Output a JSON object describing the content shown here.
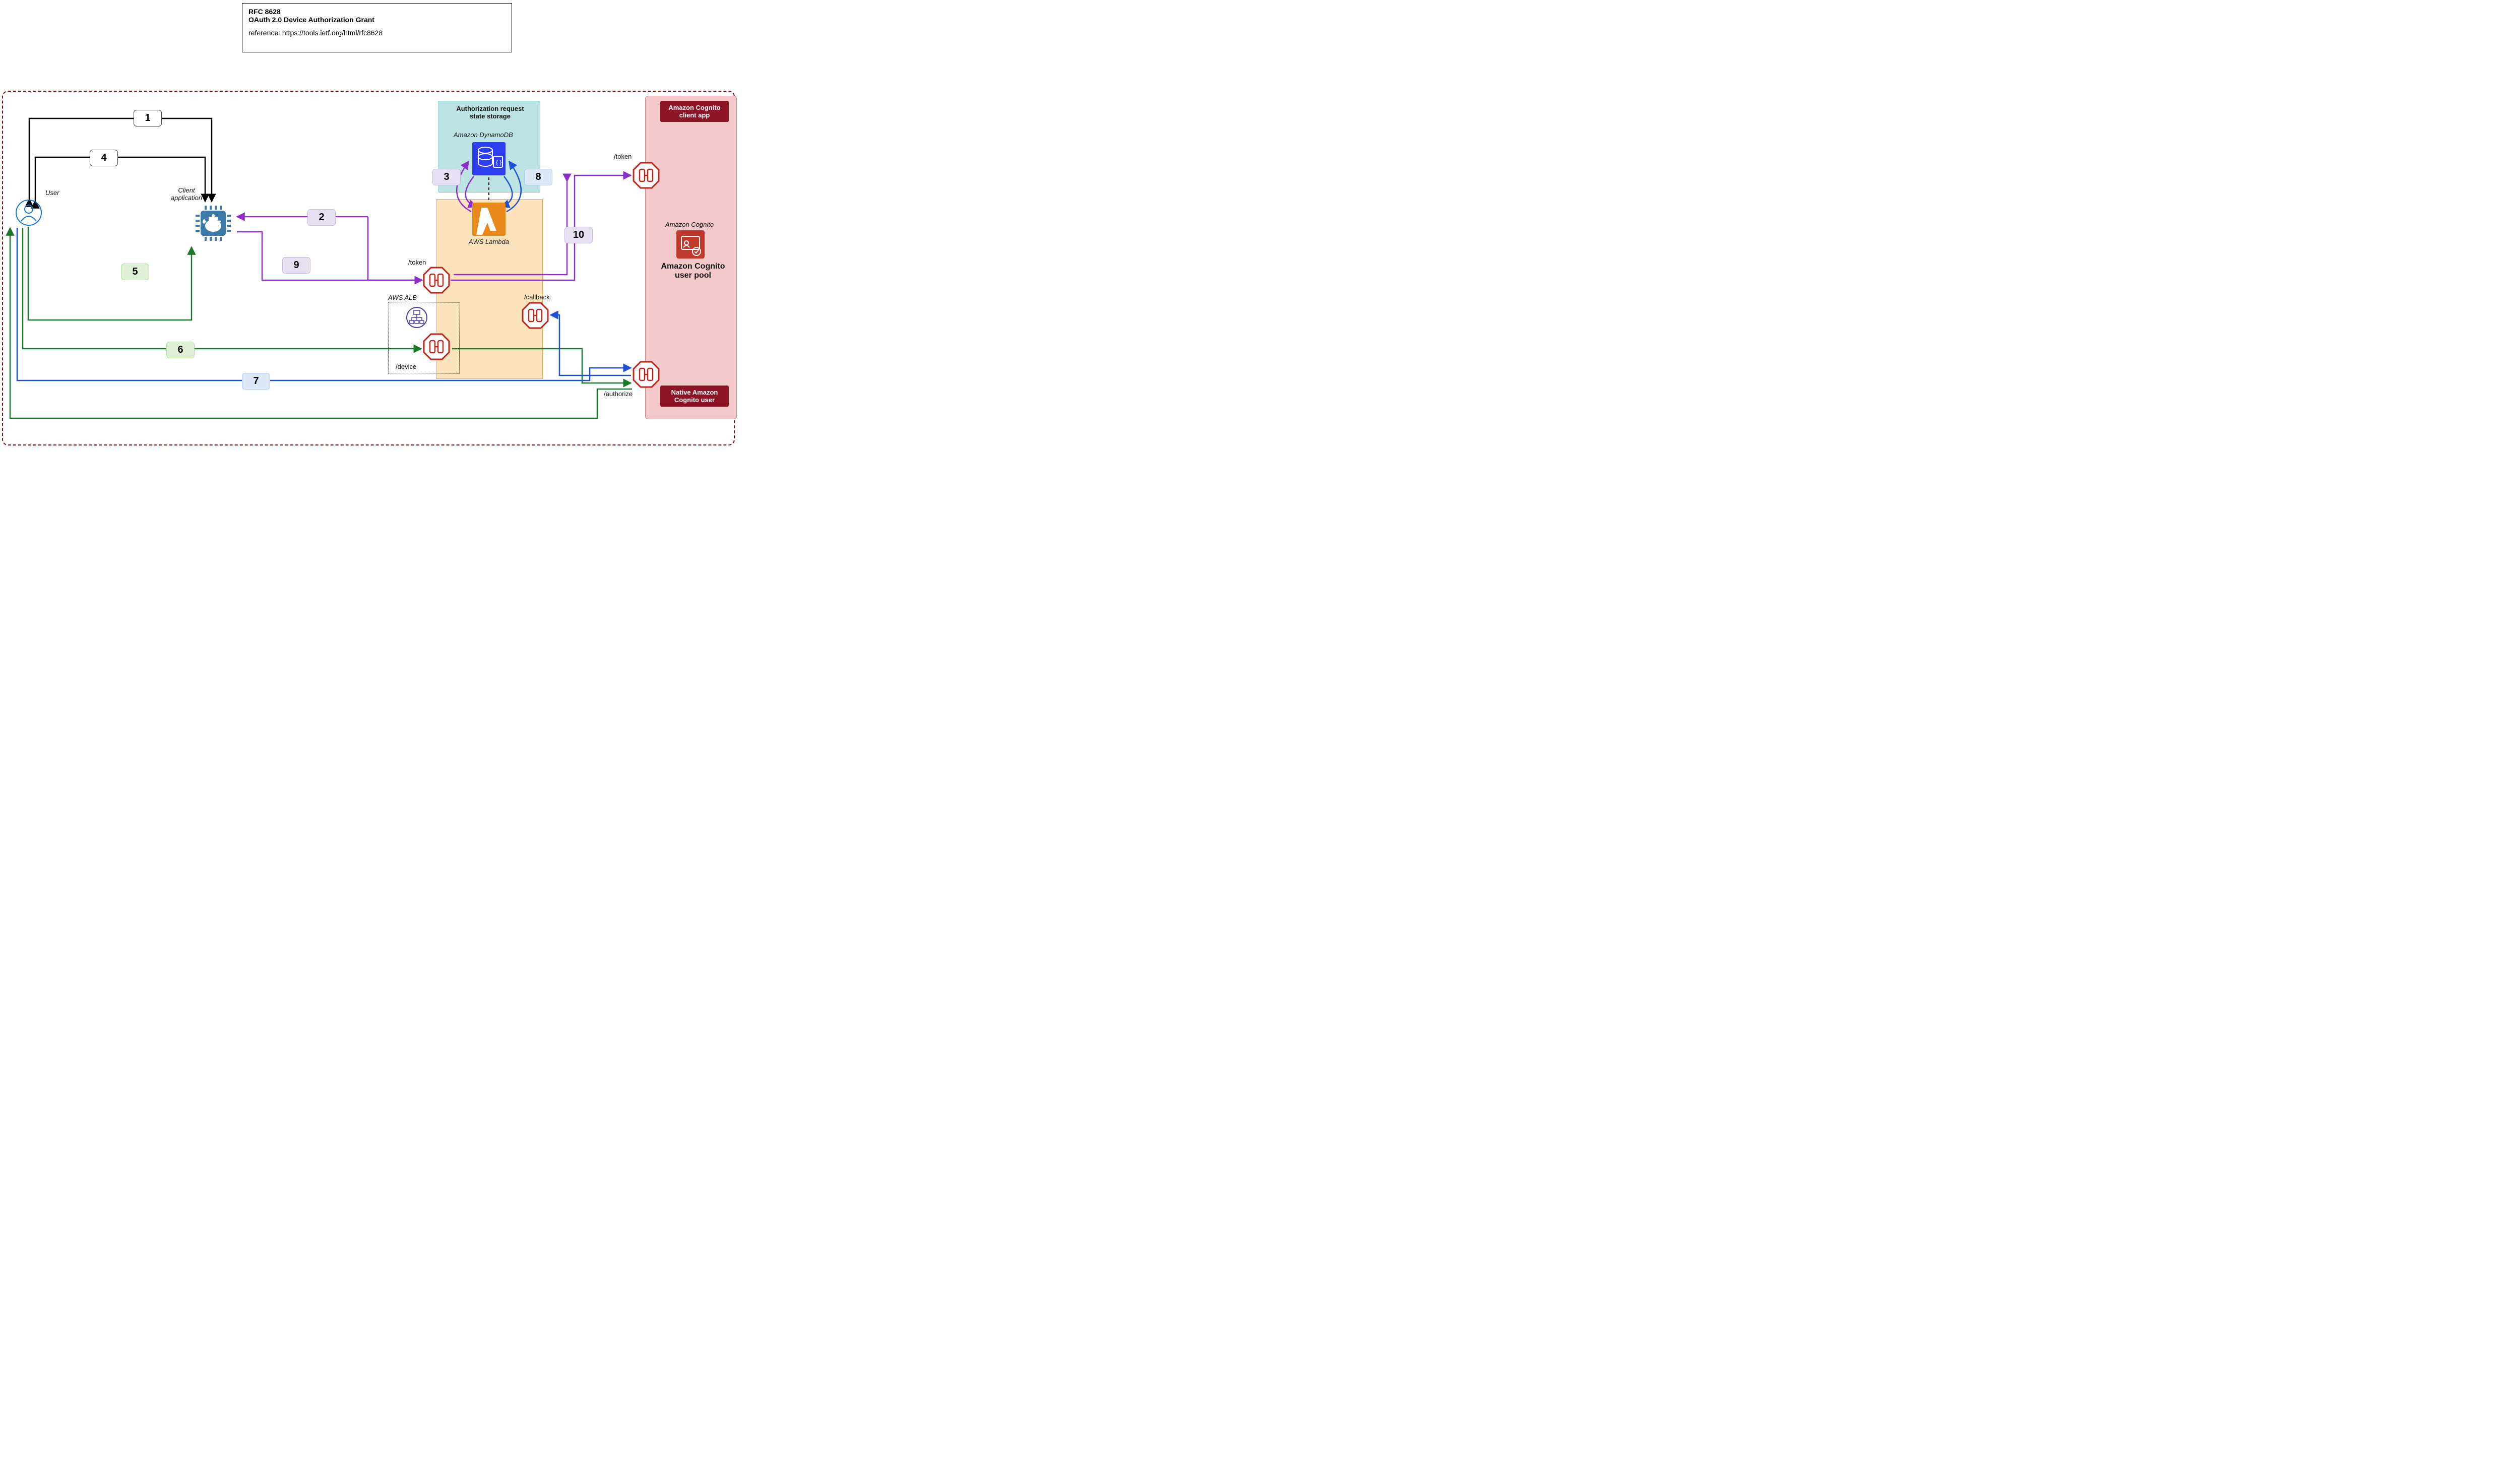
{
  "title": {
    "line1": "RFC 8628",
    "line2": "OAuth 2.0 Device Authorization Grant",
    "ref": "reference: https://tools.ietf.org/html/rfc8628"
  },
  "actors": {
    "user": "User",
    "client_app": "Client application",
    "aws_alb": "AWS ALB",
    "aws_lambda": "AWS Lambda",
    "dynamodb_box": "Authorization request state storage",
    "dynamodb": "Amazon DynamoDB",
    "cognito_label": "Amazon Cognito",
    "cognito_pool": "Amazon Cognito user pool",
    "cognito_client_app": "Amazon Cognito client app",
    "cognito_native_user": "Native Amazon Cognito user"
  },
  "endpoints": {
    "token": "/token",
    "device": "/device",
    "callback": "/callback",
    "authorize": "/authorize",
    "token2": "/token"
  },
  "steps": {
    "s1": "1",
    "s2": "2",
    "s3": "3",
    "s4": "4",
    "s5": "5",
    "s6": "6",
    "s7": "7",
    "s8": "8",
    "s9": "9",
    "s10": "10"
  }
}
